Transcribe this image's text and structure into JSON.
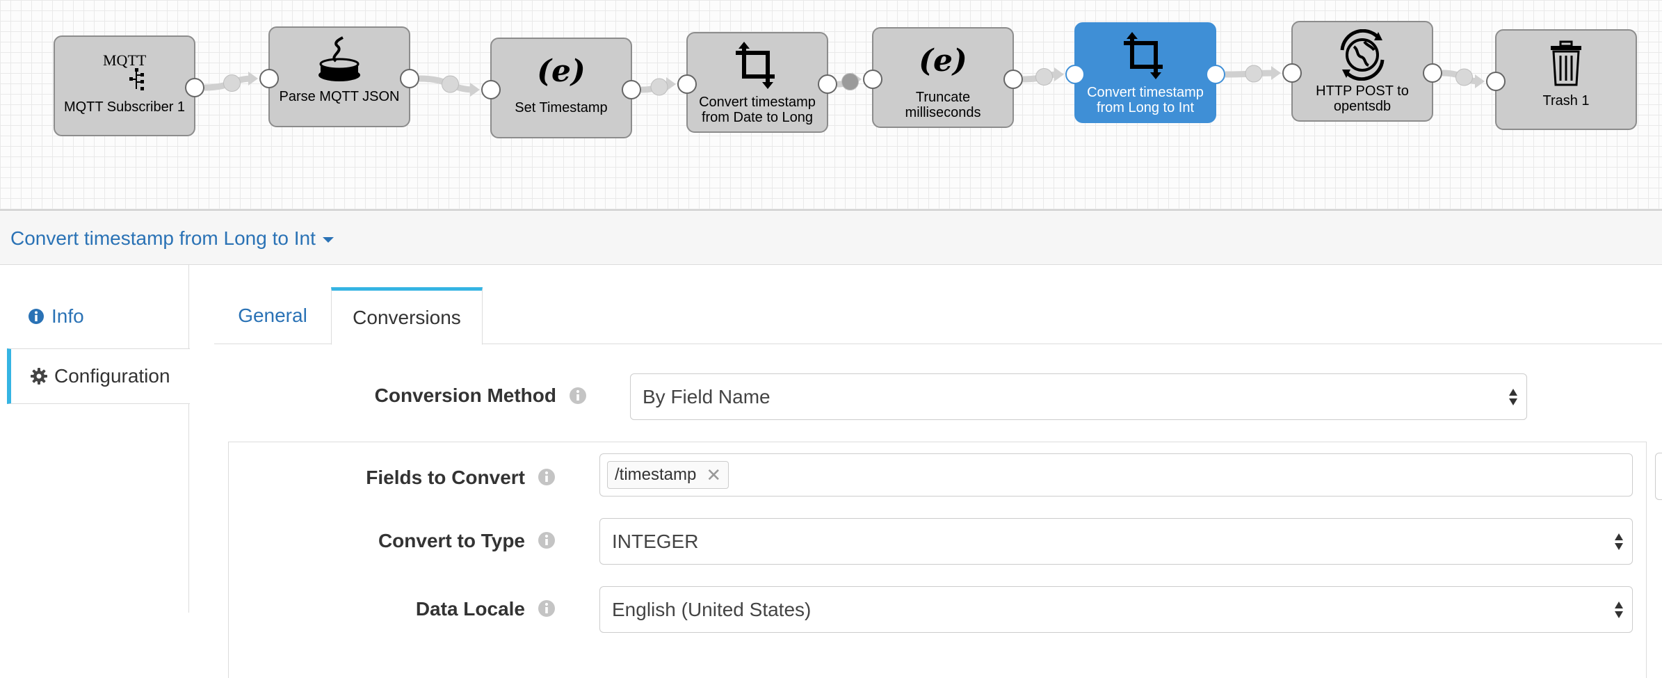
{
  "pipeline": {
    "stages": [
      {
        "label": "MQTT Subscriber 1",
        "icon": "mqtt-icon",
        "selected": false
      },
      {
        "label": "Parse MQTT JSON",
        "icon": "jython-icon",
        "selected": false
      },
      {
        "label": "Set Timestamp",
        "icon": "expression-icon",
        "selected": false
      },
      {
        "label": "Convert timestamp from Date to Long",
        "icon": "crop-icon",
        "selected": false
      },
      {
        "label": "Truncate milliseconds",
        "icon": "expression-icon",
        "selected": false
      },
      {
        "label": "Convert timestamp from Long to Int",
        "icon": "crop-icon",
        "selected": true
      },
      {
        "label": "HTTP POST to opentsdb",
        "icon": "http-globe-icon",
        "selected": false
      },
      {
        "label": "Trash 1",
        "icon": "trash-icon",
        "selected": false
      }
    ],
    "mqtt_icon_text": "MQTT",
    "selected_color": "#3f8fd6"
  },
  "detail": {
    "title": "Convert timestamp from Long to Int"
  },
  "side_nav": {
    "info_label": "Info",
    "config_label": "Configuration"
  },
  "tabs": {
    "general": "General",
    "conversions": "Conversions"
  },
  "form": {
    "conversion_method": {
      "label": "Conversion Method",
      "value": "By Field Name"
    },
    "fields_to_convert": {
      "label": "Fields to Convert",
      "tags": [
        "/timestamp"
      ]
    },
    "convert_to_type": {
      "label": "Convert to Type",
      "value": "INTEGER"
    },
    "data_locale": {
      "label": "Data Locale",
      "value": "English (United States)"
    }
  },
  "colors": {
    "link": "#2a72b5",
    "accent": "#35b4e3"
  }
}
